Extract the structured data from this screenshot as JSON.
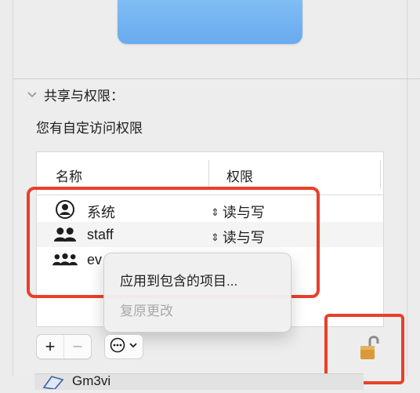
{
  "section": {
    "title": "共享与权限：",
    "custom_access": "您有自定访问权限"
  },
  "table": {
    "columns": [
      "名称",
      "权限"
    ],
    "rows": [
      {
        "name": "系统",
        "permission": "读与写",
        "icon": "user-circle-icon"
      },
      {
        "name": "staff",
        "permission": "读与写",
        "icon": "group-icon"
      },
      {
        "name": "ev",
        "permission": "",
        "icon": "everyone-icon"
      }
    ]
  },
  "context_menu": {
    "items": [
      "应用到包含的项目...",
      "复原更改"
    ]
  },
  "toolbar": {
    "add": "+",
    "remove": "−",
    "more_icon": "ellipsis-circle-icon",
    "dropdown_icon": "chevron-down-icon"
  },
  "lock": {
    "icon": "lock-open-icon"
  },
  "bottom": {
    "filename": "Gm3vi"
  },
  "colors": {
    "highlight": "#e8402a",
    "folder_blue": "#6aaaf0"
  }
}
